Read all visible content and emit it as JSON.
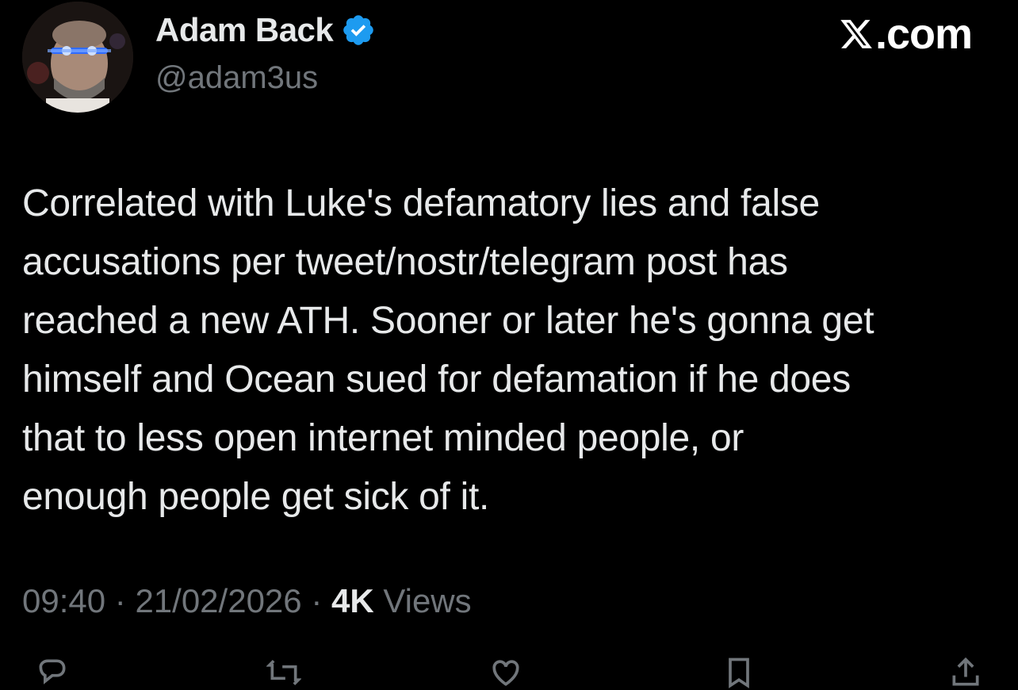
{
  "author": {
    "display_name": "Adam Back",
    "handle": "@adam3us",
    "verified_icon": "verified-badge-icon",
    "avatar": "avatar"
  },
  "site": {
    "logo_icon": "x-logo-icon",
    "label": ".com"
  },
  "tweet": {
    "text": "Correlated with Luke's defamatory lies and false\naccusations per tweet/nostr/telegram post has\nreached a new ATH. Sooner or later he's gonna get\nhimself and Ocean sued for defamation if he does\nthat to less open internet minded people, or\nenough people get sick of it."
  },
  "meta": {
    "time": "09:40",
    "separator": " · ",
    "date": "21/02/2026",
    "views_count": "4K",
    "views_label": " Views"
  },
  "actions": [
    "reply-icon",
    "repost-icon",
    "like-icon",
    "bookmark-icon",
    "share-icon"
  ],
  "colors": {
    "background": "#000000",
    "text": "#e7e9ea",
    "muted": "#71767b",
    "verified": "#1d9bf0"
  }
}
